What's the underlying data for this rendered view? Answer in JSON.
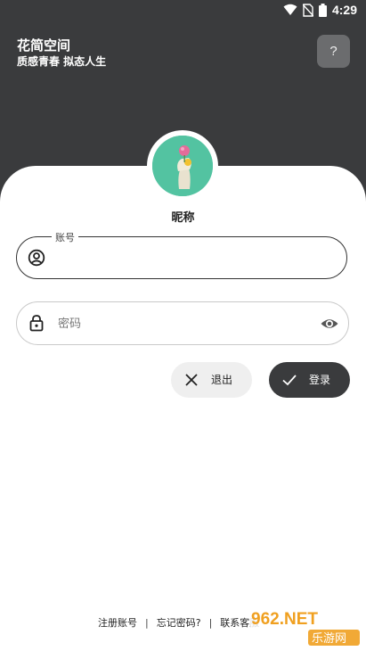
{
  "status_bar": {
    "time": "4:29"
  },
  "header": {
    "app_title": "花简空间",
    "app_subtitle": "质感青春  拟态人生",
    "help_label": "?"
  },
  "profile": {
    "nickname": "昵称"
  },
  "form": {
    "account": {
      "legend": "账号",
      "value": "",
      "placeholder": ""
    },
    "password": {
      "placeholder": "密码",
      "value": ""
    }
  },
  "actions": {
    "exit_label": "退出",
    "login_label": "登录"
  },
  "footer": {
    "register": "注册账号",
    "forgot": "忘记密码?",
    "contact": "联系客服",
    "separator": "|"
  },
  "watermark": {
    "text_top": "962.NET",
    "text_bottom": "乐游网"
  },
  "colors": {
    "header_bg": "#3a3b3d",
    "avatar_bg": "#53c3a1",
    "login_button": "#3a3b3d",
    "exit_button": "#efefef"
  }
}
